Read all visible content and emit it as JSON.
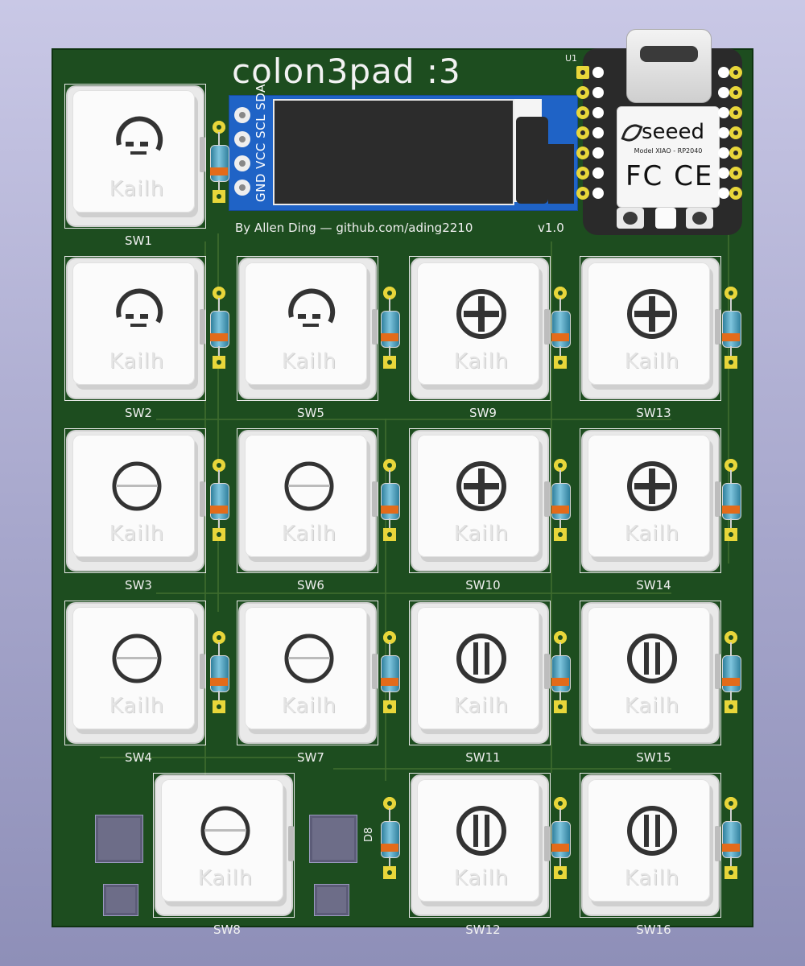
{
  "board": {
    "title": "colon3pad :3",
    "credit": "By Allen Ding — github.com/ading2210",
    "version": "v1.0",
    "u1_label": "U1",
    "d8_label": "D8"
  },
  "oled": {
    "pin_labels": "GND VCC SCL SDA"
  },
  "xiao": {
    "brand": "seeed",
    "model": "Model XIAO - RP2040",
    "marks": "FC CE"
  },
  "keys": {
    "brand": "Kailh",
    "labels": {
      "sw1": "SW1",
      "sw2": "SW2",
      "sw3": "SW3",
      "sw4": "SW4",
      "sw5": "SW5",
      "sw6": "SW6",
      "sw7": "SW7",
      "sw8": "SW8",
      "sw9": "SW9",
      "sw10": "SW10",
      "sw11": "SW11",
      "sw12": "SW12",
      "sw13": "SW13",
      "sw14": "SW14",
      "sw15": "SW15",
      "sw16": "SW16"
    }
  },
  "colors": {
    "pcb": "#1d4d1f",
    "silkscreen": "#f0f0f0",
    "pad": "#e8d63a",
    "oled_board": "#1f63c6",
    "diode_band": "#e36b1a"
  }
}
